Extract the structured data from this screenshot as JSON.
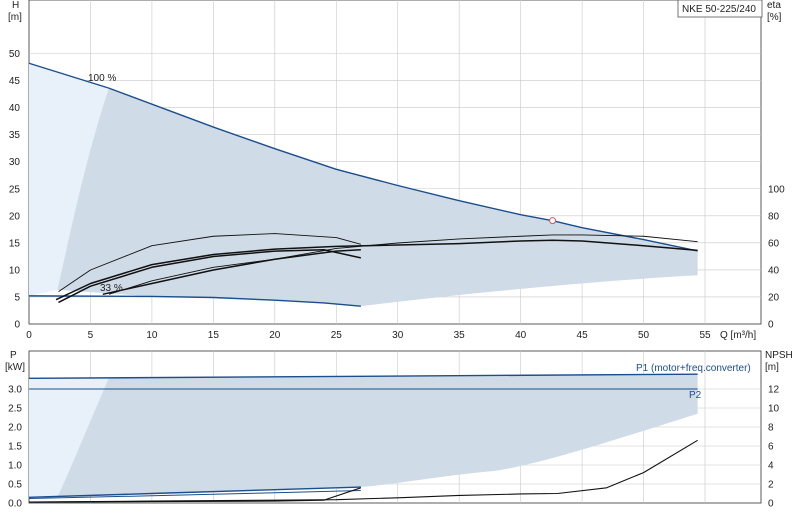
{
  "colors": {
    "envelope_fill": "#cfdbe7",
    "envelope_light": "#e8f1fa",
    "curve_blue": "#1b4e8c",
    "curve_black": "#111111",
    "grid": "#c8c8c8",
    "axis": "#333333",
    "op_point": "#e05050"
  },
  "chart_data": [
    {
      "type": "line",
      "title": "NKE 50-225/240",
      "xlabel": "Q [m³/h]",
      "ylabel": "H\n[m]",
      "ylabel_right": "eta\n[%]",
      "xlim": [
        0,
        55
      ],
      "ylim": [
        0,
        55
      ],
      "ylim_right": [
        0,
        200
      ],
      "x_ticks": [
        0,
        5,
        10,
        15,
        20,
        25,
        30,
        35,
        40,
        45,
        50,
        55
      ],
      "y_ticks": [
        0,
        5,
        10,
        15,
        20,
        25,
        30,
        35,
        40,
        45,
        50
      ],
      "y_ticks_right": [
        0,
        20,
        40,
        60,
        80,
        100
      ],
      "labels": {
        "speed_max": "100 %",
        "speed_min": "33 %"
      },
      "operating_point": {
        "x": 42.6,
        "y": 19.1
      },
      "series": [
        {
          "role": "head_max",
          "color": "#1b4e8c",
          "axis": "left",
          "x": [
            0,
            6.5,
            15,
            20,
            25,
            30,
            35,
            40,
            42.6,
            45,
            50,
            54.4
          ],
          "y": [
            48.2,
            43.6,
            36.4,
            32.4,
            28.6,
            25.6,
            22.8,
            20.2,
            19.1,
            17.8,
            15.6,
            13.5
          ]
        },
        {
          "role": "head_min",
          "color": "#1b4e8c",
          "axis": "left",
          "x": [
            0,
            10,
            15,
            20,
            24,
            27
          ],
          "y": [
            5.2,
            5.1,
            4.9,
            4.4,
            3.9,
            3.3
          ]
        },
        {
          "role": "efficiency_max",
          "color": "#111111",
          "axis": "right",
          "x": [
            2.2,
            5,
            10,
            15,
            20,
            25,
            30,
            35,
            40,
            42.6,
            45,
            50,
            54.4
          ],
          "y": [
            18,
            30,
            44,
            51.5,
            55.5,
            57.5,
            58.5,
            59.5,
            61.5,
            62,
            61.5,
            58,
            54.5
          ]
        },
        {
          "role": "efficiency_system",
          "color": "#111111",
          "axis": "right",
          "x": [
            6.5,
            10,
            15,
            20,
            25,
            30,
            35,
            40,
            42.6,
            45,
            50,
            54.4
          ],
          "y": [
            22,
            32,
            42,
            48,
            56,
            60,
            63,
            65,
            66,
            66,
            65,
            61
          ]
        },
        {
          "role": "efficiency_mid",
          "color": "#111111",
          "axis": "right",
          "x": [
            6,
            10,
            15,
            20,
            25,
            27
          ],
          "y": [
            22,
            30,
            40,
            48,
            54,
            55
          ]
        },
        {
          "role": "efficiency_min",
          "color": "#111111",
          "axis": "right",
          "x": [
            2.4,
            5,
            10,
            15,
            20,
            25,
            27
          ],
          "y": [
            24,
            40,
            58,
            65,
            67,
            64,
            59
          ]
        },
        {
          "role": "efficiency_min_p2",
          "color": "#111111",
          "axis": "right",
          "x": [
            2.4,
            5,
            10,
            15,
            20,
            24,
            27
          ],
          "y": [
            16,
            28,
            42,
            50,
            54,
            55,
            49
          ]
        }
      ]
    },
    {
      "type": "line",
      "ylabel": "P\n[kW]",
      "ylabel_right": "NPSH\n[m]",
      "xlim": [
        0,
        55
      ],
      "ylim": [
        0,
        3.5
      ],
      "ylim_right": [
        0,
        14
      ],
      "y_ticks": [
        0,
        0.5,
        1.0,
        1.5,
        2.0,
        2.5,
        3.0
      ],
      "y_ticks_right": [
        0,
        2,
        4,
        6,
        8,
        10,
        12
      ],
      "series": [
        {
          "name": "P1 (motor+freq.converter)",
          "color": "#1b4e8c",
          "axis": "left",
          "x": [
            0,
            54.4
          ],
          "y": [
            3.28,
            3.39
          ]
        },
        {
          "name": "P2",
          "color": "#1b4e8c",
          "axis": "left",
          "x": [
            0,
            54.4
          ],
          "y": [
            3.0,
            3.0
          ]
        },
        {
          "role": "p1_min",
          "color": "#1b4e8c",
          "axis": "left",
          "x": [
            0,
            10,
            20,
            27
          ],
          "y": [
            0.15,
            0.25,
            0.35,
            0.42
          ]
        },
        {
          "role": "p2_min",
          "color": "#1b4e8c",
          "axis": "left",
          "x": [
            0,
            10,
            20,
            27
          ],
          "y": [
            0.12,
            0.19,
            0.27,
            0.33
          ]
        },
        {
          "role": "npsh_max",
          "color": "#111111",
          "axis": "right",
          "x": [
            0,
            10,
            20,
            25,
            30,
            35,
            40,
            43,
            47,
            50,
            54.4
          ],
          "y": [
            0.1,
            0.2,
            0.3,
            0.35,
            0.55,
            0.8,
            0.95,
            1.0,
            1.6,
            3.2,
            6.6
          ]
        },
        {
          "role": "npsh_min",
          "color": "#111111",
          "axis": "right",
          "x": [
            0,
            10,
            20,
            24,
            27
          ],
          "y": [
            0.1,
            0.15,
            0.2,
            0.3,
            1.6
          ]
        }
      ]
    }
  ]
}
